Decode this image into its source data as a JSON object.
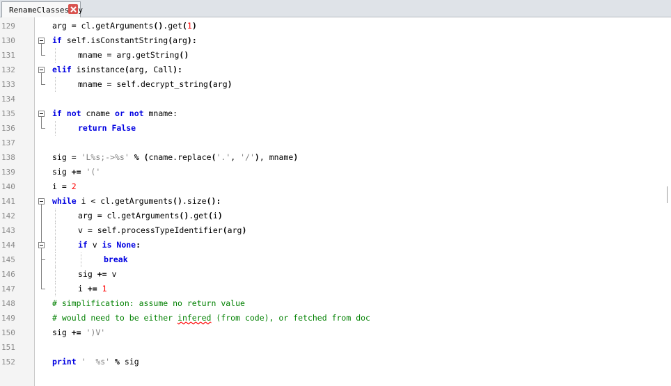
{
  "tab": {
    "label": "RenameClasses.py"
  },
  "lines": [
    {
      "n": "129",
      "indent": 2,
      "tokens": [
        [
          "t",
          "arg = cl.getArguments"
        ],
        [
          "o",
          "()"
        ],
        [
          "t",
          ".get"
        ],
        [
          "o",
          "("
        ],
        [
          "num",
          "1"
        ],
        [
          "o",
          ")"
        ]
      ]
    },
    {
      "n": "130",
      "indent": 2,
      "tokens": [
        [
          "kw",
          "if"
        ],
        [
          "t",
          " self.isConstantString"
        ],
        [
          "o",
          "("
        ],
        [
          "t",
          "arg"
        ],
        [
          "o",
          "):"
        ]
      ]
    },
    {
      "n": "131",
      "indent": 3,
      "tokens": [
        [
          "t",
          "mname = arg.getString"
        ],
        [
          "o",
          "()"
        ]
      ]
    },
    {
      "n": "132",
      "indent": 2,
      "tokens": [
        [
          "kw",
          "elif"
        ],
        [
          "t",
          " isinstance"
        ],
        [
          "o",
          "("
        ],
        [
          "t",
          "arg, Call"
        ],
        [
          "o",
          "):"
        ]
      ]
    },
    {
      "n": "133",
      "indent": 3,
      "tokens": [
        [
          "t",
          "mname = self.decrypt_string"
        ],
        [
          "o",
          "("
        ],
        [
          "t",
          "arg"
        ],
        [
          "o",
          ")"
        ]
      ]
    },
    {
      "n": "134",
      "indent": 0,
      "tokens": []
    },
    {
      "n": "135",
      "indent": 2,
      "tokens": [
        [
          "kw",
          "if not"
        ],
        [
          "t",
          " cname "
        ],
        [
          "kw",
          "or not"
        ],
        [
          "t",
          " mname:"
        ]
      ]
    },
    {
      "n": "136",
      "indent": 3,
      "tokens": [
        [
          "kw",
          "return False"
        ]
      ]
    },
    {
      "n": "137",
      "indent": 0,
      "tokens": []
    },
    {
      "n": "138",
      "indent": 2,
      "tokens": [
        [
          "t",
          "sig = "
        ],
        [
          "str",
          "'L%s;->%s'"
        ],
        [
          "t",
          " "
        ],
        [
          "o",
          "%"
        ],
        [
          "t",
          " "
        ],
        [
          "o",
          "("
        ],
        [
          "t",
          "cname.replace"
        ],
        [
          "o",
          "("
        ],
        [
          "str",
          "'.'"
        ],
        [
          "t",
          ", "
        ],
        [
          "str",
          "'/'"
        ],
        [
          "o",
          ")"
        ],
        [
          "t",
          ", mname"
        ],
        [
          "o",
          ")"
        ]
      ]
    },
    {
      "n": "139",
      "indent": 2,
      "tokens": [
        [
          "t",
          "sig "
        ],
        [
          "o",
          "+="
        ],
        [
          "t",
          " "
        ],
        [
          "str",
          "'('"
        ]
      ]
    },
    {
      "n": "140",
      "indent": 2,
      "tokens": [
        [
          "t",
          "i = "
        ],
        [
          "num",
          "2"
        ]
      ]
    },
    {
      "n": "141",
      "indent": 2,
      "tokens": [
        [
          "kw",
          "while"
        ],
        [
          "t",
          " i < cl.getArguments"
        ],
        [
          "o",
          "()"
        ],
        [
          "t",
          ".size"
        ],
        [
          "o",
          "():"
        ]
      ]
    },
    {
      "n": "142",
      "indent": 3,
      "tokens": [
        [
          "t",
          "arg = cl.getArguments"
        ],
        [
          "o",
          "()"
        ],
        [
          "t",
          ".get"
        ],
        [
          "o",
          "("
        ],
        [
          "t",
          "i"
        ],
        [
          "o",
          ")"
        ]
      ]
    },
    {
      "n": "143",
      "indent": 3,
      "tokens": [
        [
          "t",
          "v = self.processTypeIdentifier"
        ],
        [
          "o",
          "("
        ],
        [
          "t",
          "arg"
        ],
        [
          "o",
          ")"
        ]
      ]
    },
    {
      "n": "144",
      "indent": 3,
      "tokens": [
        [
          "kw",
          "if"
        ],
        [
          "t",
          " v "
        ],
        [
          "kw",
          "is None"
        ],
        [
          "o",
          ":"
        ]
      ]
    },
    {
      "n": "145",
      "indent": 4,
      "tokens": [
        [
          "kw",
          "break"
        ]
      ]
    },
    {
      "n": "146",
      "indent": 3,
      "tokens": [
        [
          "t",
          "sig "
        ],
        [
          "o",
          "+="
        ],
        [
          "t",
          " v"
        ]
      ]
    },
    {
      "n": "147",
      "indent": 3,
      "tokens": [
        [
          "t",
          "i "
        ],
        [
          "o",
          "+="
        ],
        [
          "t",
          " "
        ],
        [
          "num",
          "1"
        ]
      ]
    },
    {
      "n": "148",
      "indent": 2,
      "tokens": [
        [
          "cmt",
          "# simplification: assume no return value"
        ]
      ]
    },
    {
      "n": "149",
      "indent": 2,
      "tokens": [
        [
          "cmt",
          "# would need to be either "
        ],
        [
          "sq",
          "infered"
        ],
        [
          "cmt",
          " (from code), or fetched from doc"
        ]
      ]
    },
    {
      "n": "150",
      "indent": 2,
      "tokens": [
        [
          "t",
          "sig "
        ],
        [
          "o",
          "+="
        ],
        [
          "t",
          " "
        ],
        [
          "str",
          "')V'"
        ]
      ]
    },
    {
      "n": "151",
      "indent": 0,
      "tokens": []
    },
    {
      "n": "152",
      "indent": 2,
      "tokens": [
        [
          "kw",
          "print"
        ],
        [
          "t",
          " "
        ],
        [
          "str",
          "'  %s'"
        ],
        [
          "t",
          " "
        ],
        [
          "o",
          "%"
        ],
        [
          "t",
          " sig"
        ]
      ]
    }
  ],
  "folds": [
    {
      "start": "130",
      "end": "131",
      "type": "open"
    },
    {
      "start": "132",
      "end": "133",
      "type": "open"
    },
    {
      "start": "135",
      "end": "136",
      "type": "open"
    },
    {
      "start": "141",
      "end": "147",
      "type": "open"
    },
    {
      "start": "144",
      "end": "145",
      "type": "open"
    }
  ],
  "colors": {
    "keyword": "#0000e1",
    "number": "#ff0000",
    "string": "#808080",
    "comment": "#008000",
    "close_button": "#d9534f"
  }
}
